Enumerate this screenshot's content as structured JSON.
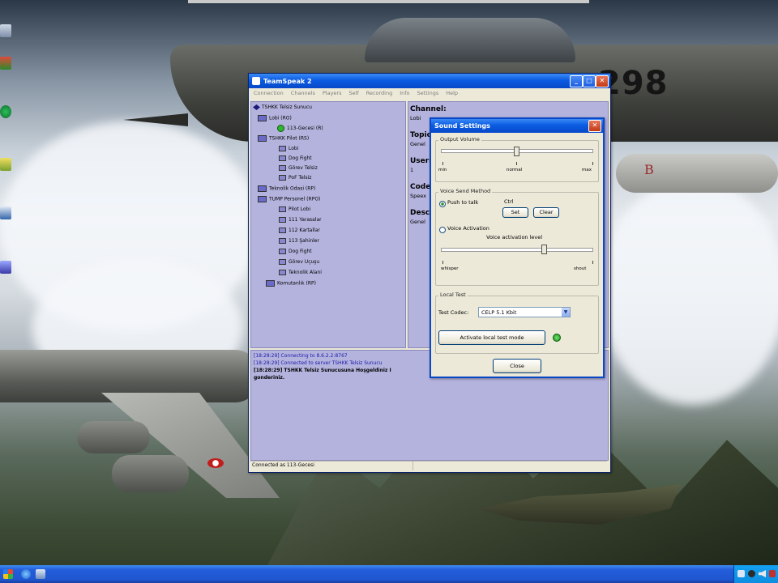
{
  "desktop": {
    "jet_marking": "298",
    "tail_marking": "B"
  },
  "teamspeak": {
    "title": "TeamSpeak 2",
    "menu": [
      "Connection",
      "Channels",
      "Players",
      "Self",
      "Recording",
      "Info",
      "Settings",
      "Help"
    ],
    "tree": [
      {
        "label": "TSHKK Telsiz Sunucu",
        "level": 0,
        "kind": "server"
      },
      {
        "label": "Lobi   (RO)",
        "level": 1,
        "kind": "channel"
      },
      {
        "label": "113-Gecesi  (R)",
        "level": 2,
        "kind": "player"
      },
      {
        "label": "TSHKK Pilot   (RS)",
        "level": 1,
        "kind": "channel"
      },
      {
        "label": "Lobi",
        "level": 2,
        "kind": "sub"
      },
      {
        "label": "Dog Fight",
        "level": 2,
        "kind": "sub"
      },
      {
        "label": "Görev Telsiz",
        "level": 2,
        "kind": "sub"
      },
      {
        "label": "PoF Telsiz",
        "level": 2,
        "kind": "sub"
      },
      {
        "label": "Teknolik Odasi   (RP)",
        "level": 1,
        "kind": "channel"
      },
      {
        "label": "TUMP Personel   (RPO)",
        "level": 1,
        "kind": "channel"
      },
      {
        "label": "Pilot Lobi",
        "level": 2,
        "kind": "sub"
      },
      {
        "label": "111 Yarasalar",
        "level": 2,
        "kind": "sub"
      },
      {
        "label": "112 Kartallar",
        "level": 2,
        "kind": "sub"
      },
      {
        "label": "113 Şahinler",
        "level": 2,
        "kind": "sub"
      },
      {
        "label": "Dog Fight",
        "level": 2,
        "kind": "sub"
      },
      {
        "label": "Görev Uçuşu",
        "level": 2,
        "kind": "sub"
      },
      {
        "label": "Teknolik Alani",
        "level": 2,
        "kind": "sub"
      },
      {
        "label": "Komutanlık   (RP)",
        "level": 1,
        "kind": "channel"
      }
    ],
    "info_panel": {
      "channel_heading": "Channel:",
      "channel_value": "Lobi",
      "topic_heading": "Topic:",
      "topic_value": "Genel",
      "users_heading": "Users:",
      "users_value": "1",
      "codec_heading": "Codec:",
      "codec_value": "Speex",
      "desc_heading": "Description:",
      "desc_value": "Genel"
    },
    "log": [
      "[18:28:29] Connecting to 8.6.2.2:8767",
      "[18:28:29] Connected to server TSHKK Telsiz Sunucu",
      "[18:28:29] TSHKK Telsiz Sunucusuna Hoşgeldiniz I",
      "gonderiniz."
    ],
    "status": "Connected as 113-Gecesi"
  },
  "sound_settings": {
    "title": "Sound Settings",
    "output_volume": {
      "label": "Output Volume",
      "tick_min": "min",
      "tick_normal": "normal",
      "tick_max": "max"
    },
    "voice_send": {
      "label": "Voice Send Method",
      "push_to_talk": "Push to talk",
      "hotkey": "Ctrl",
      "set_button": "Set",
      "clear_button": "Clear",
      "voice_activation": "Voice Activation",
      "activation_level": "Voice activation level",
      "tick_whisper": "whisper",
      "tick_shout": "shout"
    },
    "local_test": {
      "label": "Local Test",
      "codec_label": "Test Codec:",
      "codec_value": "CELP 5.1 Kbit",
      "activate_button": "Activate local test mode"
    },
    "close_button": "Close"
  },
  "colors": {
    "xp_blue": "#0a5ce2",
    "lavender": "#b4b3de",
    "led_green": "#2fb52f"
  }
}
